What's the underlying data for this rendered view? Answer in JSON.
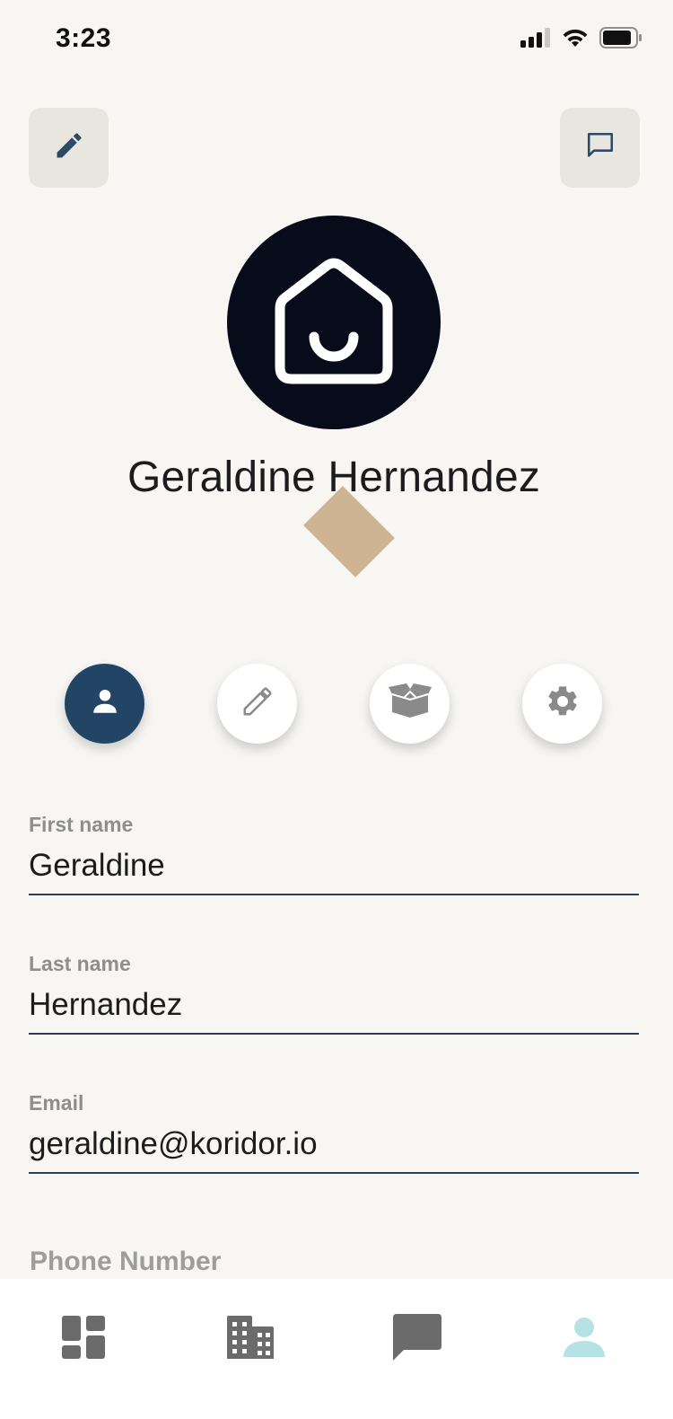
{
  "status_bar": {
    "time": "3:23"
  },
  "header": {
    "edit_icon": "pencil-icon",
    "chat_icon": "chat-bubble-icon"
  },
  "profile": {
    "name": "Geraldine Hernandez",
    "avatar_icon": "house-smile-logo"
  },
  "actions": [
    {
      "icon": "person-icon",
      "active": true
    },
    {
      "icon": "pencil-icon",
      "active": false
    },
    {
      "icon": "box-icon",
      "active": false
    },
    {
      "icon": "gear-icon",
      "active": false
    }
  ],
  "form": {
    "first_name": {
      "label": "First name",
      "value": "Geraldine"
    },
    "last_name": {
      "label": "Last name",
      "value": "Hernandez"
    },
    "email": {
      "label": "Email",
      "value": "geraldine@koridor.io"
    },
    "phone": {
      "label": "Phone Number"
    }
  },
  "tab_bar": [
    {
      "icon": "dashboard-icon",
      "active": false
    },
    {
      "icon": "building-icon",
      "active": false
    },
    {
      "icon": "chat-icon",
      "active": false
    },
    {
      "icon": "profile-icon",
      "active": true
    }
  ],
  "colors": {
    "background": "#f7f6f3",
    "accent_navy": "#234565",
    "avatar_bg": "#070b1a",
    "tab_active": "#b7e2e5",
    "tab_inactive": "#6b6b6b",
    "decoration": "#cfb494"
  }
}
